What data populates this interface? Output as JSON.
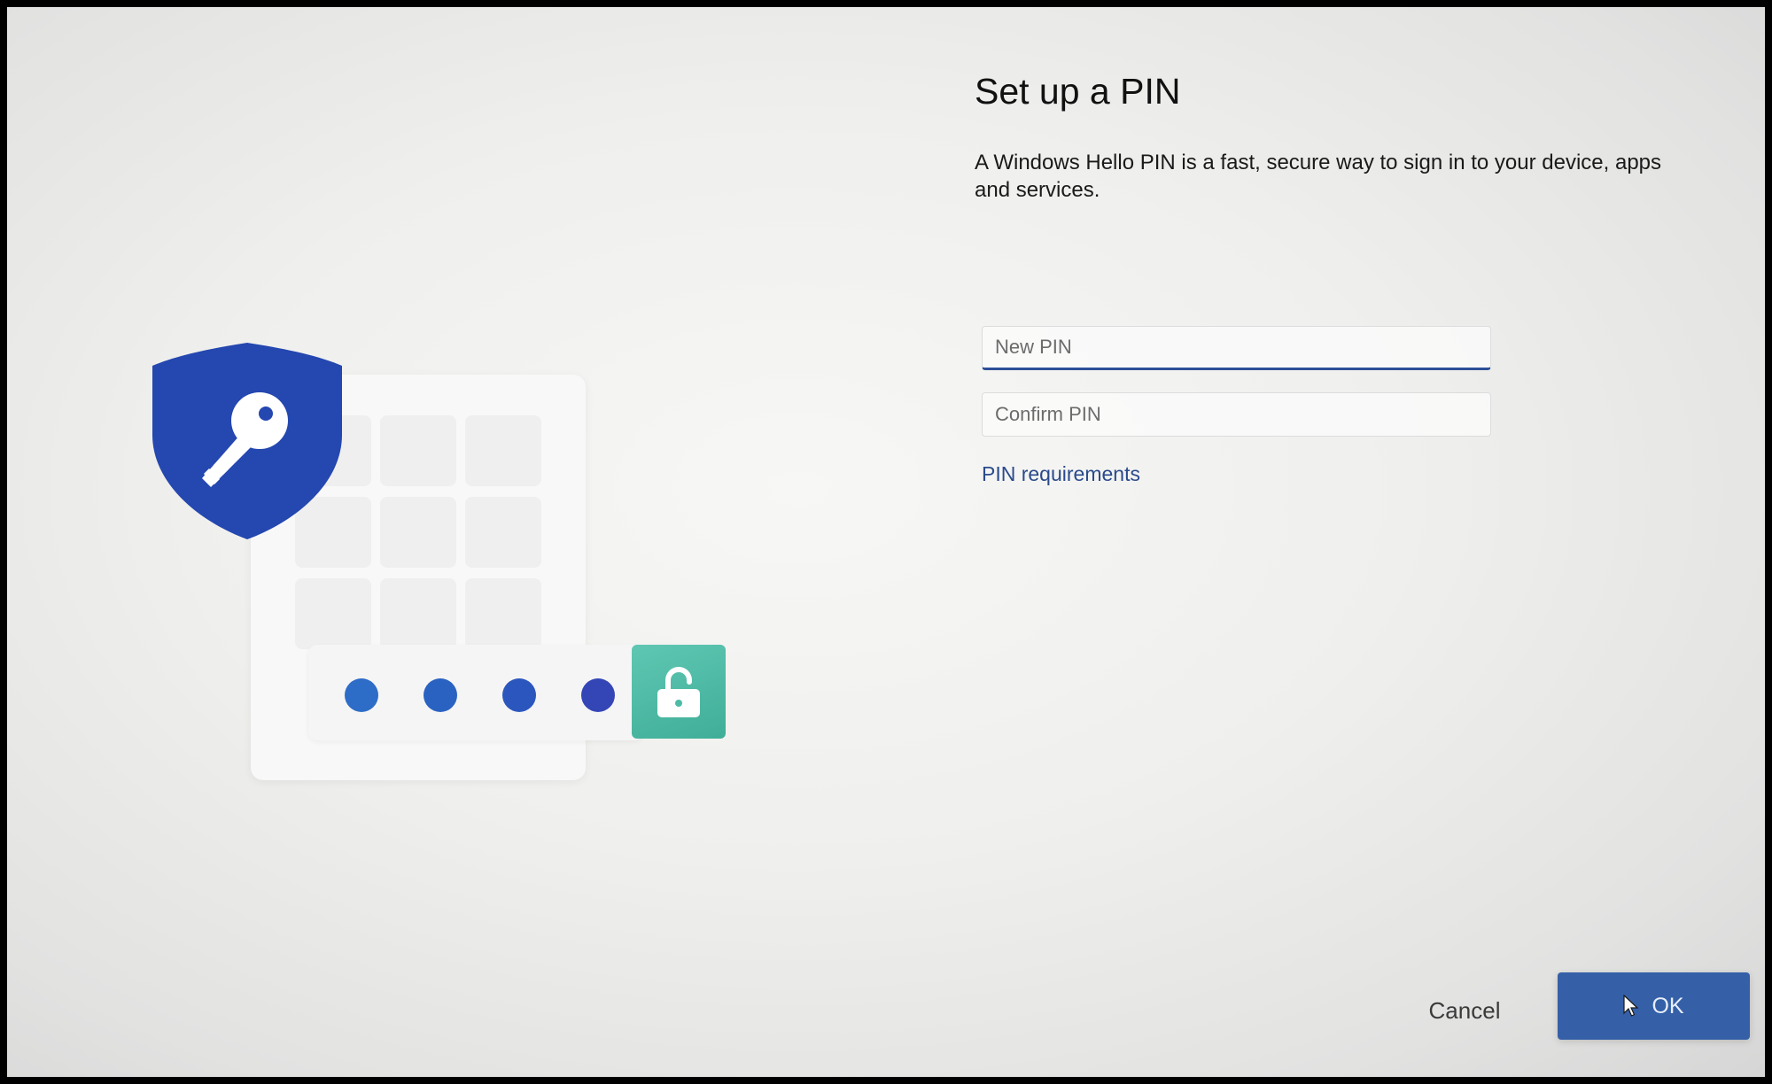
{
  "page": {
    "title": "Set up a PIN",
    "description": "A Windows Hello PIN is a fast, secure way to sign in to your device, apps and services."
  },
  "form": {
    "new_pin": {
      "value": "",
      "placeholder": "New PIN"
    },
    "confirm_pin": {
      "value": "",
      "placeholder": "Confirm PIN"
    },
    "requirements_label": "PIN requirements"
  },
  "actions": {
    "cancel_label": "Cancel",
    "ok_label": "OK"
  },
  "illustration": {
    "icons": [
      "shield-icon",
      "key-icon",
      "unlocked-padlock-icon"
    ],
    "pin_dots": 4
  },
  "colors": {
    "accent": "#3560a8",
    "shield": "#2447b0",
    "lock_tile": "#4dbba5",
    "link": "#2a4a8c"
  }
}
